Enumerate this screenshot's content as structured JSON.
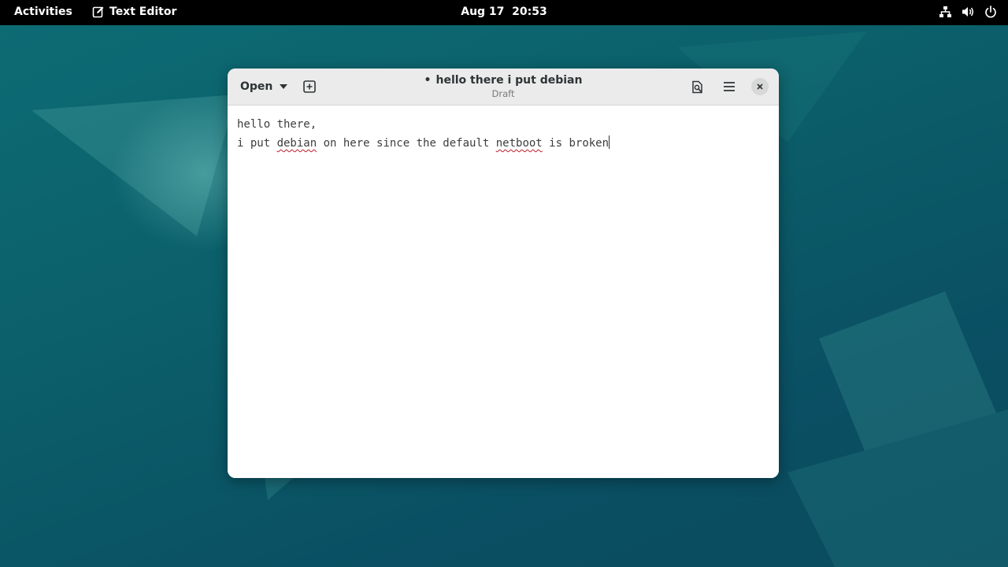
{
  "topbar": {
    "activities": "Activities",
    "app_name": "Text Editor",
    "date": "Aug 17",
    "time": "20:53",
    "tray_icons": [
      "network-wired-icon",
      "volume-icon",
      "power-icon"
    ]
  },
  "window": {
    "open_label": "Open",
    "title": "hello there i put debian",
    "modified_marker": "•",
    "subtitle": "Draft"
  },
  "editor": {
    "line1": "hello there,",
    "line2_parts": [
      "i put ",
      "debian",
      " on here since the default ",
      "netboot",
      " is broken"
    ]
  },
  "colors": {
    "desktop": "#0b5f6a",
    "topbar": "#000000",
    "headerbar": "#ebebeb",
    "spell_underline": "#c01c28"
  }
}
